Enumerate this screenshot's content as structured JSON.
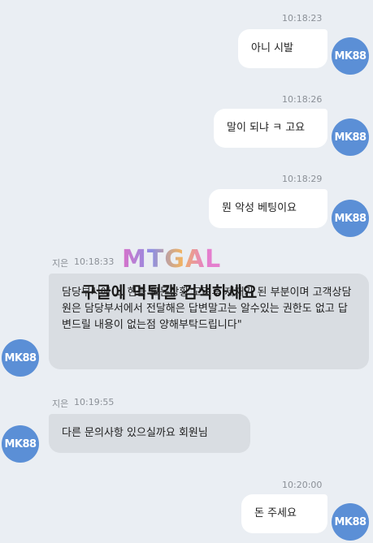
{
  "avatar_label": "MK88",
  "messages": [
    {
      "time": "10:18:23",
      "text": "아니 시발"
    },
    {
      "time": "10:18:26",
      "text": "말이 되냐 ㅋ 고요"
    },
    {
      "time": "10:18:29",
      "text": "뭔 악성 베팅이요"
    },
    {
      "sender": "지은",
      "time": "10:18:33",
      "text": "담당부서에 ... 현금 모든상황 고려후 제재가 된 부분이며 고객상담원은 담당부서에서 전달해은 답변말고는 알수있는 권한도 없고 답변드릴 내용이 없는점 양해부탁드립니다\""
    },
    {
      "sender": "지은",
      "time": "10:19:55",
      "text": "다른 문의사항 있으실까요 회원님"
    },
    {
      "time": "10:20:00",
      "text": "돈 주세요"
    }
  ],
  "watermark": {
    "logo": "MTGAL",
    "text": "구글에 먹튀갤 검색하세요"
  },
  "colors": {
    "background": "#eaeef3",
    "outgoing_bubble": "#ffffff",
    "incoming_bubble": "#d9dde2",
    "avatar": "#5b8fd6"
  }
}
